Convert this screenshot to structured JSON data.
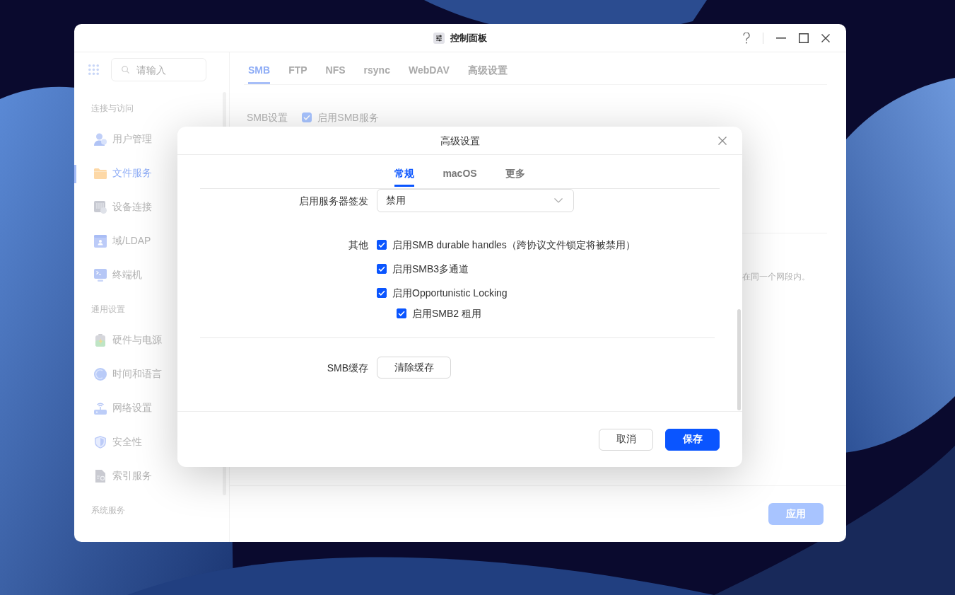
{
  "window": {
    "title": "控制面板"
  },
  "sidebar": {
    "search": {
      "placeholder": "请输入"
    },
    "sections": [
      {
        "title": "连接与访问",
        "items": [
          {
            "label": "用户管理",
            "selected": false
          },
          {
            "label": "文件服务",
            "selected": true
          },
          {
            "label": "设备连接",
            "selected": false
          },
          {
            "label": "域/LDAP",
            "selected": false
          },
          {
            "label": "终端机",
            "selected": false
          }
        ]
      },
      {
        "title": "通用设置",
        "items": [
          {
            "label": "硬件与电源",
            "selected": false
          },
          {
            "label": "时间和语言",
            "selected": false
          },
          {
            "label": "网络设置",
            "selected": false
          },
          {
            "label": "安全性",
            "selected": false
          },
          {
            "label": "索引服务",
            "selected": false
          }
        ]
      },
      {
        "title": "系统服务"
      }
    ]
  },
  "tabs": [
    {
      "label": "SMB",
      "selected": true
    },
    {
      "label": "FTP",
      "selected": false
    },
    {
      "label": "NFS",
      "selected": false
    },
    {
      "label": "rsync",
      "selected": false
    },
    {
      "label": "WebDAV",
      "selected": false
    },
    {
      "label": "高级设置",
      "selected": false
    }
  ],
  "smb_settings": {
    "label": "SMB设置",
    "option": {
      "label": "启用SMB服务",
      "checked": true
    }
  },
  "note": "在同一个网段内。",
  "footer": {
    "apply_button": "应用"
  },
  "dialog": {
    "title": "高级设置",
    "tabs": [
      {
        "label": "常规",
        "selected": true
      },
      {
        "label": "macOS",
        "selected": false
      },
      {
        "label": "更多",
        "selected": false
      }
    ],
    "signing": {
      "label": "启用服务器签发",
      "value": "禁用"
    },
    "other": {
      "label": "其他",
      "options": [
        {
          "label": "启用SMB durable handles（跨协议文件锁定将被禁用）",
          "checked": true
        },
        {
          "label": "启用SMB3多通道",
          "checked": true
        },
        {
          "label": "启用Opportunistic Locking",
          "checked": true,
          "children": [
            {
              "label": "启用SMB2 租用",
              "checked": true
            }
          ]
        }
      ]
    },
    "cache": {
      "label": "SMB缓存",
      "button": "清除缓存"
    },
    "buttons": [
      {
        "label": "取消",
        "kind": "secondary"
      },
      {
        "label": "保存",
        "kind": "primary"
      }
    ]
  }
}
